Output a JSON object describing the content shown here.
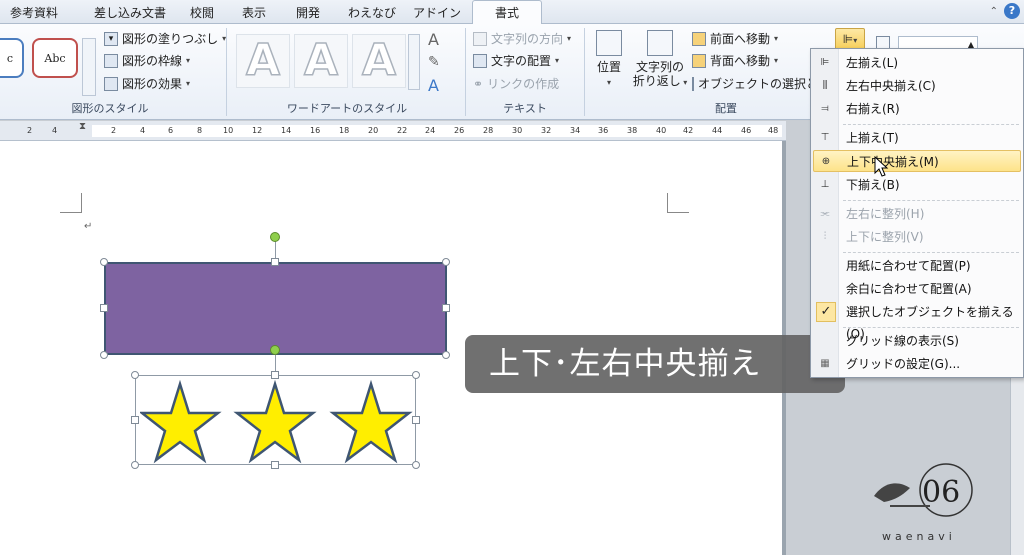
{
  "tabs": [
    "参考資料",
    "差し込み文書",
    "校閲",
    "表示",
    "開発",
    "わえなび",
    "アドイン",
    "書式"
  ],
  "active_tab": "書式",
  "ribbon": {
    "shape_style_label": "Abc",
    "shape_fill": "図形の塗りつぶし",
    "shape_outline": "図形の枠線",
    "shape_effects": "図形の効果",
    "group_shape_styles": "図形のスタイル",
    "wordart_letter": "A",
    "group_wordart": "ワードアートのスタイル",
    "text_direction": "文字列の方向",
    "text_align": "文字の配置",
    "create_link": "リンクの作成",
    "group_text": "テキスト",
    "position": "位置",
    "wrap_text_line1": "文字列の",
    "wrap_text_line2": "折り返し",
    "bring_forward": "前面へ移動",
    "send_backward": "背面へ移動",
    "selection_pane": "オブジェクトの選択と表",
    "group_arrange": "配置"
  },
  "ruler_ticks": [
    "4",
    "2",
    "2",
    "4",
    "6",
    "8",
    "10",
    "12",
    "14",
    "16",
    "18",
    "20",
    "22",
    "24",
    "26",
    "28",
    "30",
    "32",
    "34",
    "36",
    "38",
    "40",
    "42",
    "44",
    "46",
    "48"
  ],
  "menu": {
    "items": [
      {
        "label": "左揃え(L)",
        "icon": "align-left-icon",
        "disabled": false
      },
      {
        "label": "左右中央揃え(C)",
        "icon": "align-center-icon",
        "disabled": false
      },
      {
        "label": "右揃え(R)",
        "icon": "align-right-icon",
        "disabled": false
      },
      {
        "label": "上揃え(T)",
        "icon": "align-top-icon",
        "disabled": false
      },
      {
        "label": "上下中央揃え(M)",
        "icon": "align-middle-icon",
        "disabled": false,
        "hover": true
      },
      {
        "label": "下揃え(B)",
        "icon": "align-bottom-icon",
        "disabled": false
      },
      {
        "label": "左右に整列(H)",
        "icon": "distribute-horizontal-icon",
        "disabled": true
      },
      {
        "label": "上下に整列(V)",
        "icon": "distribute-vertical-icon",
        "disabled": true
      },
      {
        "label": "用紙に合わせて配置(P)",
        "icon": "",
        "disabled": false
      },
      {
        "label": "余白に合わせて配置(A)",
        "icon": "",
        "disabled": false
      },
      {
        "label": "選択したオブジェクトを揃える(O)",
        "icon": "check-icon",
        "disabled": false,
        "checked": true
      },
      {
        "label": "グリッド線の表示(S)",
        "icon": "",
        "disabled": false
      },
      {
        "label": "グリッドの設定(G)...",
        "icon": "grid-icon",
        "disabled": false
      }
    ]
  },
  "tooltip_text": "上下･左右中央揃え",
  "logo_text": "waenavi",
  "colors": {
    "rectangle_fill": "#7e63a1",
    "star_fill": "#ffee00",
    "star_outline": "#3f5672",
    "menu_hover": "#fde38a"
  }
}
